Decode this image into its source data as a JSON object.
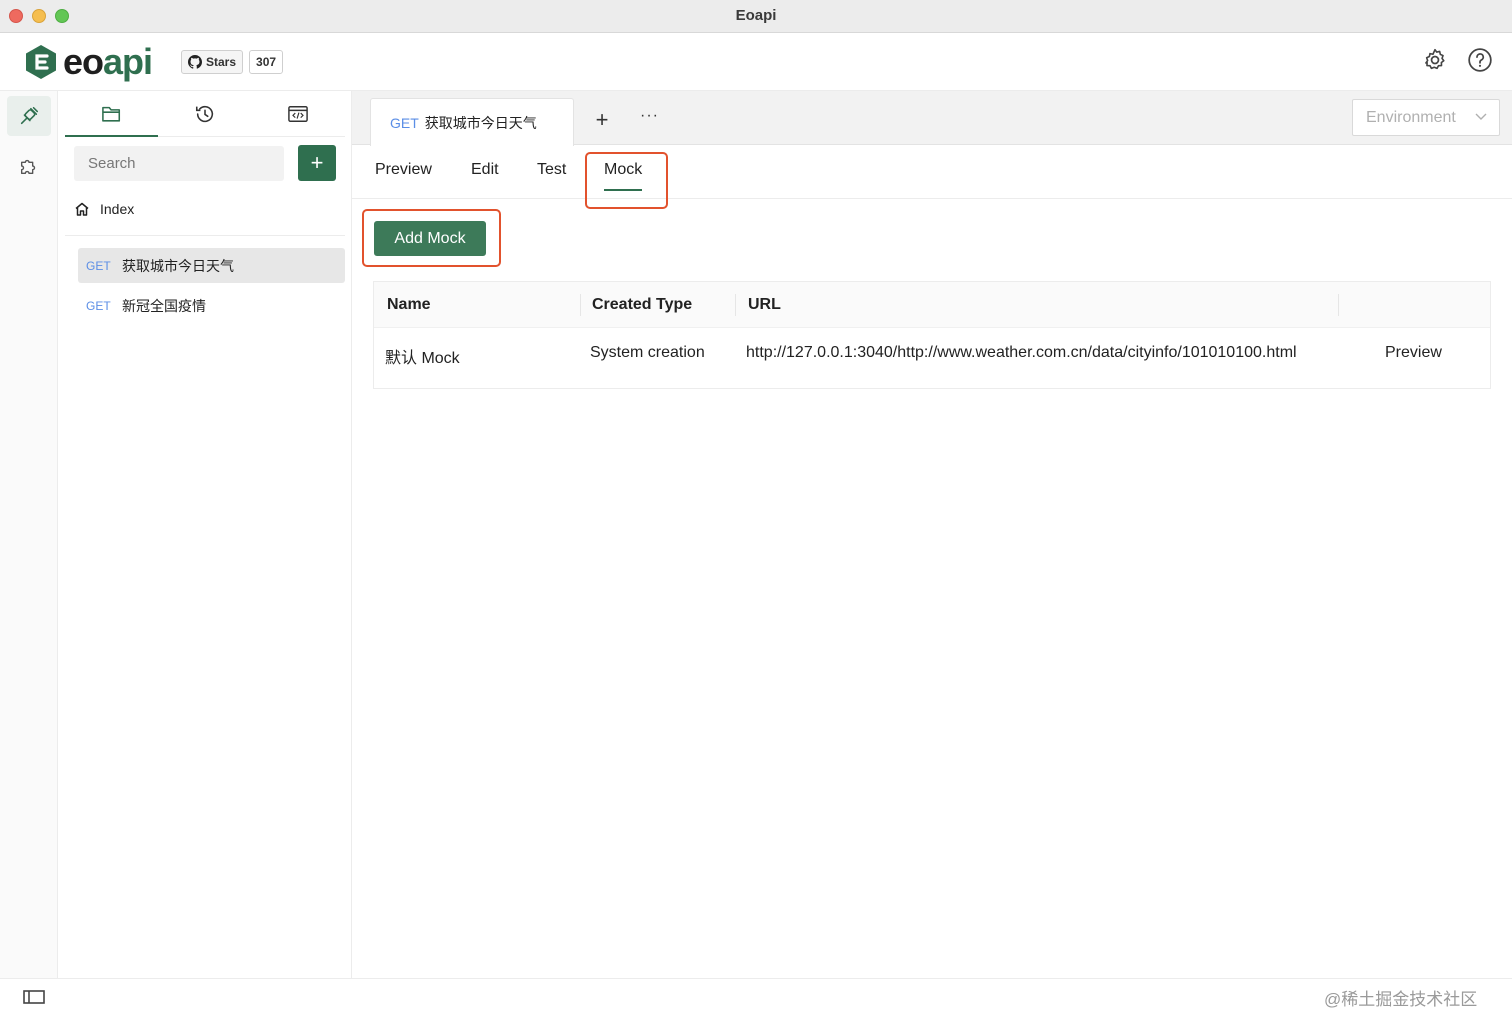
{
  "window": {
    "title": "Eoapi"
  },
  "header": {
    "logo_text_a": "eo",
    "logo_text_b": "api",
    "github_stars_label": "Stars",
    "github_stars_count": "307"
  },
  "sidebar": {
    "search_placeholder": "Search",
    "add_label": "+",
    "index_label": "Index",
    "apis": [
      {
        "method": "GET",
        "name": "获取城市今日天气"
      },
      {
        "method": "GET",
        "name": "新冠全国疫情"
      }
    ]
  },
  "tabs": {
    "active_method": "GET",
    "active_name": "获取城市今日天气",
    "add_label": "+",
    "more_label": "···",
    "environment_placeholder": "Environment"
  },
  "subtabs": [
    "Preview",
    "Edit",
    "Test",
    "Mock"
  ],
  "mock": {
    "add_button": "Add Mock",
    "columns": [
      "Name",
      "Created Type",
      "URL"
    ],
    "rows": [
      {
        "name": "默认 Mock",
        "created_type": "System creation",
        "url": "http://127.0.0.1:3040/http://www.weather.com.cn/data/cityinfo/101010100.html",
        "action": "Preview"
      }
    ]
  },
  "watermark": "@稀土掘金技术社区",
  "colors": {
    "brand": "#2f6f4f",
    "button": "#3d7a59",
    "method": "#5b8ee6",
    "highlight": "#e2522d"
  }
}
